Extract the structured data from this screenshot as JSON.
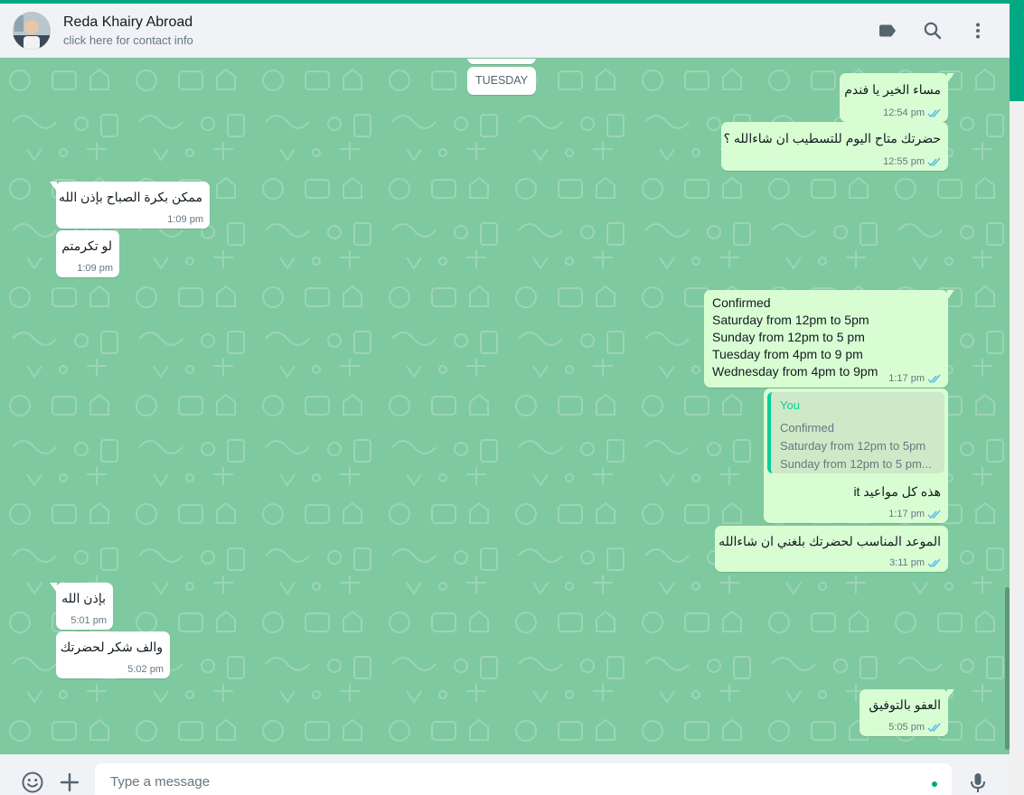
{
  "header": {
    "contact_name": "Reda Khairy Abroad",
    "contact_sub": "click here for contact info",
    "icons": [
      "label-icon",
      "search-icon",
      "menu-icon"
    ]
  },
  "chat": {
    "date_chip": "TUESDAY",
    "messages": [
      {
        "dir": "out",
        "text": "مساء الخير يا فندم",
        "time": "12:54 pm",
        "status": "read"
      },
      {
        "dir": "out",
        "text": "حضرتك متاح اليوم للتسطيب ان شاءالله ؟",
        "time": "12:55 pm",
        "status": "read"
      },
      {
        "dir": "in",
        "text": "ممكن بكرة الصباح بإذن الله",
        "time": "1:09 pm"
      },
      {
        "dir": "in",
        "text": "لو تكرمتم",
        "time": "1:09 pm"
      },
      {
        "dir": "out",
        "text": "Confirmed\nSaturday from 12pm to 5pm\nSunday from 12pm to 5 pm\nTuesday from 4pm to 9 pm\nWednesday from 4pm to 9pm",
        "time": "1:17 pm",
        "status": "read"
      },
      {
        "dir": "out",
        "quote": {
          "author": "You",
          "lines": [
            "Confirmed",
            "Saturday from 12pm to 5pm",
            "Sunday from 12pm to 5 pm..."
          ]
        },
        "text": "هذه كل مواعيد it",
        "time": "1:17 pm",
        "status": "read"
      },
      {
        "dir": "out",
        "text": "الموعد المناسب لحضرتك بلغني ان شاءالله",
        "time": "3:11 pm",
        "status": "read"
      },
      {
        "dir": "in",
        "text": "بإذن الله",
        "time": "5:01 pm"
      },
      {
        "dir": "in",
        "text": "والف شكر لحضرتك",
        "time": "5:02 pm"
      },
      {
        "dir": "out",
        "text": "العفو بالتوفيق",
        "time": "5:05 pm",
        "status": "read"
      }
    ]
  },
  "footer": {
    "placeholder": "Type a message",
    "icons": [
      "emoji-icon",
      "attach-plus-icon",
      "microphone-icon"
    ]
  },
  "colors": {
    "accent": "#00a884",
    "chat_bg": "#7fc9a0",
    "outgoing_bubble": "#d9fdd3",
    "incoming_bubble": "#ffffff",
    "read_tick": "#53bdeb"
  }
}
